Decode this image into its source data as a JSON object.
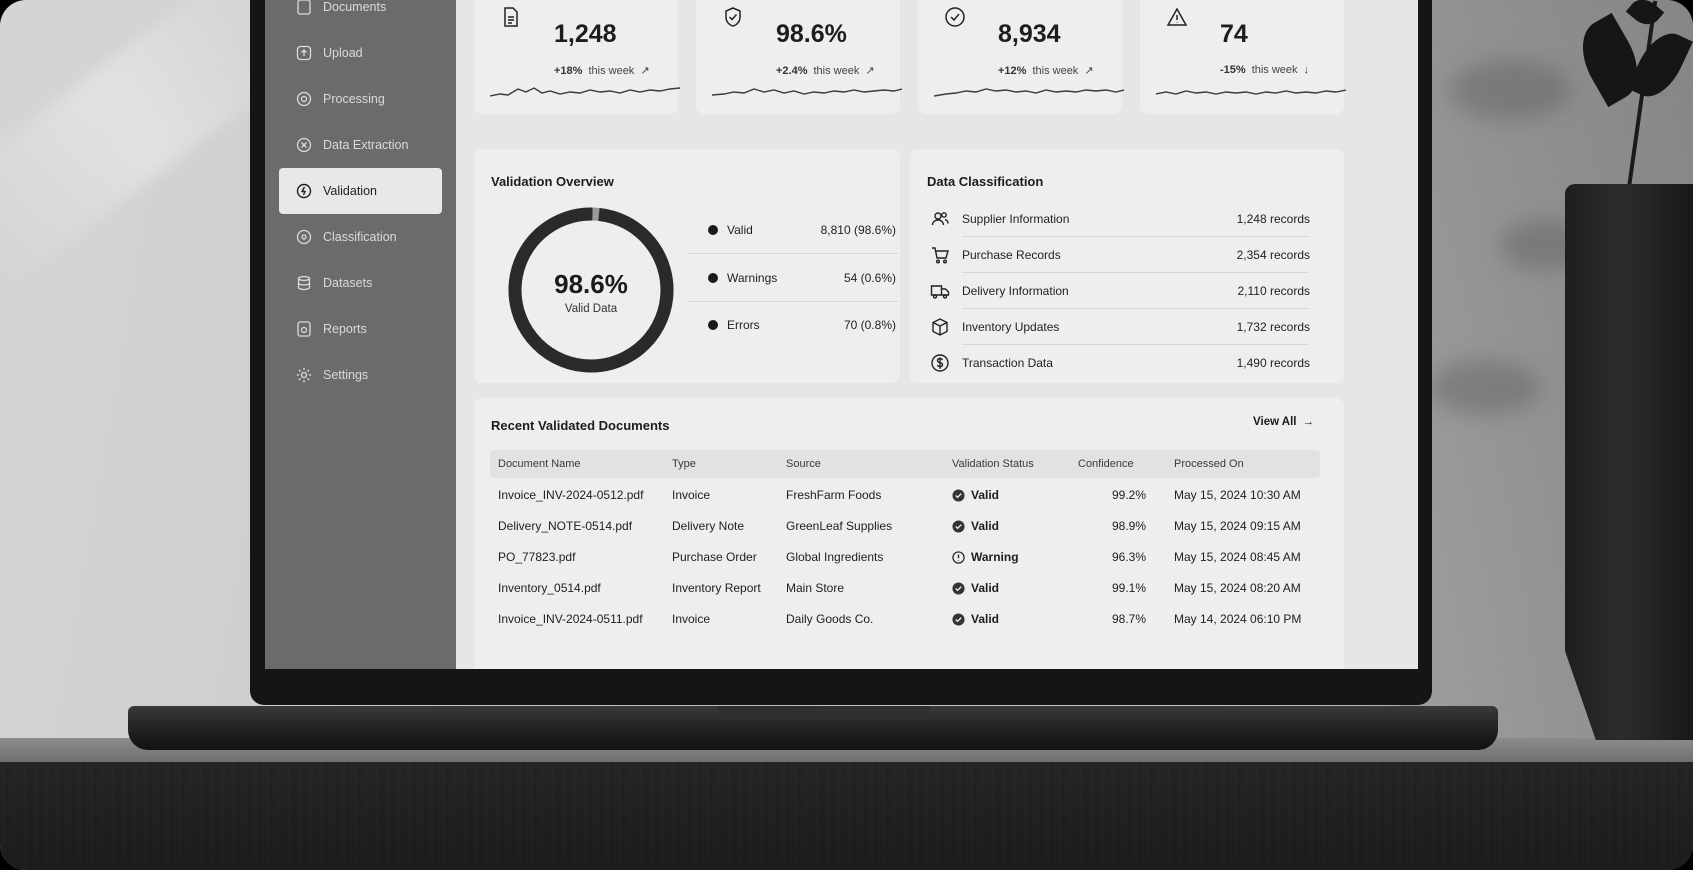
{
  "sidebar": {
    "items": [
      {
        "label": "Documents",
        "icon": "document-icon"
      },
      {
        "label": "Upload",
        "icon": "upload-icon"
      },
      {
        "label": "Processing",
        "icon": "processing-icon"
      },
      {
        "label": "Data Extraction",
        "icon": "extraction-icon"
      },
      {
        "label": "Validation",
        "icon": "validation-icon",
        "active": true
      },
      {
        "label": "Classification",
        "icon": "classification-icon"
      },
      {
        "label": "Datasets",
        "icon": "database-icon"
      },
      {
        "label": "Reports",
        "icon": "reports-icon"
      },
      {
        "label": "Settings",
        "icon": "gear-icon"
      }
    ]
  },
  "stats": [
    {
      "value": "1,248",
      "change": "+18%",
      "period": "this week",
      "trend": "up",
      "icon": "document-icon"
    },
    {
      "value": "98.6%",
      "change": "+2.4%",
      "period": "this week",
      "trend": "up",
      "icon": "shield-icon"
    },
    {
      "value": "8,934",
      "change": "+12%",
      "period": "this week",
      "trend": "up",
      "icon": "check-circle-icon"
    },
    {
      "value": "74",
      "change": "-15%",
      "period": "this week",
      "trend": "down",
      "icon": "warning-icon"
    }
  ],
  "validation_overview": {
    "title": "Validation Overview",
    "center_value": "98.6%",
    "center_label": "Valid Data",
    "valid_fraction": 0.986,
    "rows": [
      {
        "name": "Valid",
        "value": "8,810 (98.6%)"
      },
      {
        "name": "Warnings",
        "value": "54 (0.6%)"
      },
      {
        "name": "Errors",
        "value": "70 (0.8%)"
      }
    ]
  },
  "data_classification": {
    "title": "Data Classification",
    "rows": [
      {
        "name": "Supplier Information",
        "count": "1,248 records",
        "icon": "users-icon"
      },
      {
        "name": "Purchase Records",
        "count": "2,354 records",
        "icon": "cart-icon"
      },
      {
        "name": "Delivery Information",
        "count": "2,110 records",
        "icon": "truck-icon"
      },
      {
        "name": "Inventory Updates",
        "count": "1,732 records",
        "icon": "box-icon"
      },
      {
        "name": "Transaction Data",
        "count": "1,490 records",
        "icon": "dollar-icon"
      }
    ]
  },
  "recent": {
    "title": "Recent Validated Documents",
    "view_all": "View All",
    "columns": [
      "Document Name",
      "Type",
      "Source",
      "Validation Status",
      "Confidence",
      "Processed On"
    ],
    "rows": [
      {
        "name": "Invoice_INV-2024-0512.pdf",
        "type": "Invoice",
        "source": "FreshFarm Foods",
        "status": "Valid",
        "confidence": "99.2%",
        "processed": "May 15, 2024 10:30 AM"
      },
      {
        "name": "Delivery_NOTE-0514.pdf",
        "type": "Delivery Note",
        "source": "GreenLeaf Supplies",
        "status": "Valid",
        "confidence": "98.9%",
        "processed": "May 15, 2024 09:15 AM"
      },
      {
        "name": "PO_77823.pdf",
        "type": "Purchase Order",
        "source": "Global Ingredients",
        "status": "Warning",
        "confidence": "96.3%",
        "processed": "May 15, 2024 08:45 AM"
      },
      {
        "name": "Inventory_0514.pdf",
        "type": "Inventory Report",
        "source": "Main Store",
        "status": "Valid",
        "confidence": "99.1%",
        "processed": "May 15, 2024 08:20 AM"
      },
      {
        "name": "Invoice_INV-2024-0511.pdf",
        "type": "Invoice",
        "source": "Daily Goods Co.",
        "status": "Valid",
        "confidence": "98.7%",
        "processed": "May 14, 2024 06:10 PM"
      }
    ]
  }
}
